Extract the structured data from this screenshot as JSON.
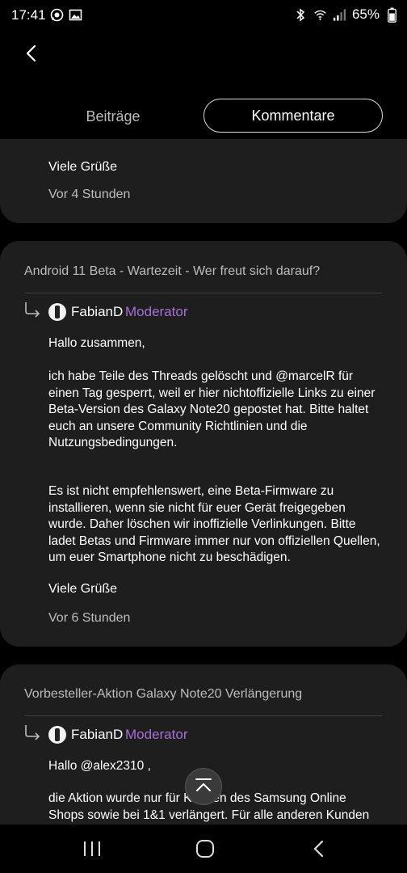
{
  "status_bar": {
    "time": "17:41",
    "battery": "65%"
  },
  "tabs": {
    "posts": "Beiträge",
    "comments": "Kommentare"
  },
  "comments": [
    {
      "body_partial": "",
      "greeting": "Viele Grüße",
      "time": "Vor 4 Stunden"
    },
    {
      "thread_title": "Android 11 Beta - Wartezeit - Wer freut sich darauf?",
      "author": "FabianD",
      "role": "Moderator",
      "salutation": "Hallo zusammen,",
      "paragraph1": "ich habe Teile des Threads gelöscht und @marcelR für einen Tag gesperrt, weil er hier nichtoffizielle Links zu einer Beta-Version des Galaxy Note20 gepostet hat. Bitte haltet euch an unsere Community Richtlinien und die Nutzungsbedingungen.",
      "paragraph2": "Es ist nicht empfehlenswert, eine Beta-Firmware zu installieren, wenn sie nicht für euer Gerät freigegeben wurde. Daher löschen wir inoffizielle Verlinkungen. Bitte ladet Betas und Firmware immer nur von offiziellen Quellen, um euer Smartphone nicht zu beschädigen.",
      "greeting": "Viele Grüße",
      "time": "Vor 6 Stunden"
    },
    {
      "thread_title": "Vorbesteller-Aktion Galaxy Note20 Verlängerung",
      "author": "FabianD",
      "role": "Moderator",
      "salutation": "Hallo @alex2310 ,",
      "paragraph1": "die Aktion wurde nur für Kunden des Samsung Online Shops sowie bei 1&1 verlängert. Für alle anderen Kunden galt der"
    }
  ],
  "colors": {
    "background": "#000000",
    "card": "#1e1e1e",
    "moderator": "#a86fd6",
    "muted": "#bdbdbd"
  }
}
